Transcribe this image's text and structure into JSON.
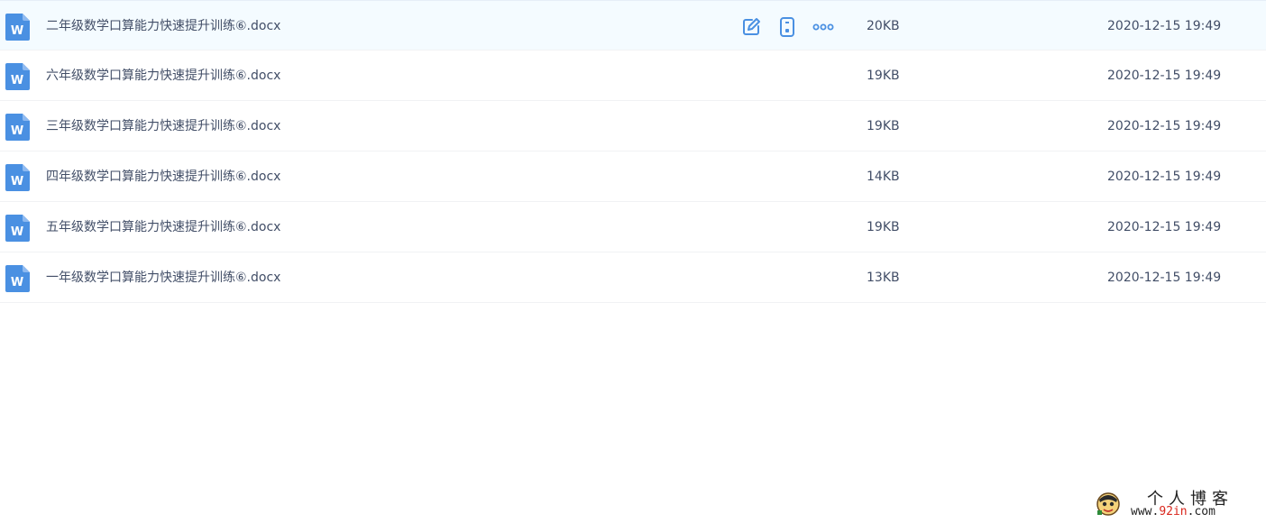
{
  "files": [
    {
      "name": "二年级数学口算能力快速提升训练⑥.docx",
      "size": "20KB",
      "date": "2020-12-15 19:49",
      "hovered": true
    },
    {
      "name": "六年级数学口算能力快速提升训练⑥.docx",
      "size": "19KB",
      "date": "2020-12-15 19:49",
      "hovered": false
    },
    {
      "name": "三年级数学口算能力快速提升训练⑥.docx",
      "size": "19KB",
      "date": "2020-12-15 19:49",
      "hovered": false
    },
    {
      "name": "四年级数学口算能力快速提升训练⑥.docx",
      "size": "14KB",
      "date": "2020-12-15 19:49",
      "hovered": false
    },
    {
      "name": "五年级数学口算能力快速提升训练⑥.docx",
      "size": "19KB",
      "date": "2020-12-15 19:49",
      "hovered": false
    },
    {
      "name": "一年级数学口算能力快速提升训练⑥.docx",
      "size": "13KB",
      "date": "2020-12-15 19:49",
      "hovered": false
    }
  ],
  "row_actions": [
    "edit-icon",
    "phone-icon",
    "more-icon"
  ],
  "file_icon": {
    "letter": "W",
    "color": "#4a90e2"
  },
  "watermark": {
    "title": "个人博客",
    "url_prefix": "www.",
    "url_accent": "92in",
    "url_suffix": ".com"
  },
  "colors": {
    "text": "#424e67",
    "accent": "#4a90e2",
    "hover_row": "#f4fbff"
  }
}
